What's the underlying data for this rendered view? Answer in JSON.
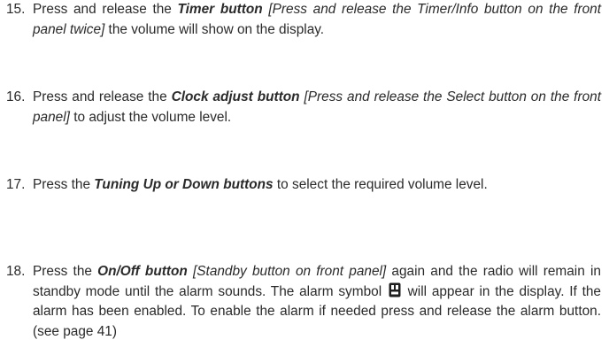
{
  "steps": [
    {
      "number": "15.",
      "t1": "Press and release the ",
      "kw1": "Timer button",
      "t2": " ",
      "note1": "[Press and release the Timer/Info button on the front panel twice]",
      "t3": " the volume will show on the display."
    },
    {
      "number": "16.",
      "t1": "Press and release the ",
      "kw1": "Clock adjust button",
      "t2": " ",
      "note1": "[Press and release the Select button on the front panel]",
      "t3": " to adjust the volume level."
    },
    {
      "number": "17.",
      "t1": "Press the ",
      "kw1": "Tuning Up or Down buttons",
      "t2": " to select the required volume level."
    },
    {
      "number": "18.",
      "t1": "Press the ",
      "kw1": "On/Off button",
      "t2": " ",
      "note1": "[Standby button on front panel]",
      "t3": " again and the radio will remain in standby mode until the alarm sounds. The alarm symbol ",
      "icon": "alarm-display-icon",
      "t4": " will appear in the display. If the alarm has been enabled. To enable the alarm if needed  press  and release the alarm button. (see page 41)"
    }
  ]
}
